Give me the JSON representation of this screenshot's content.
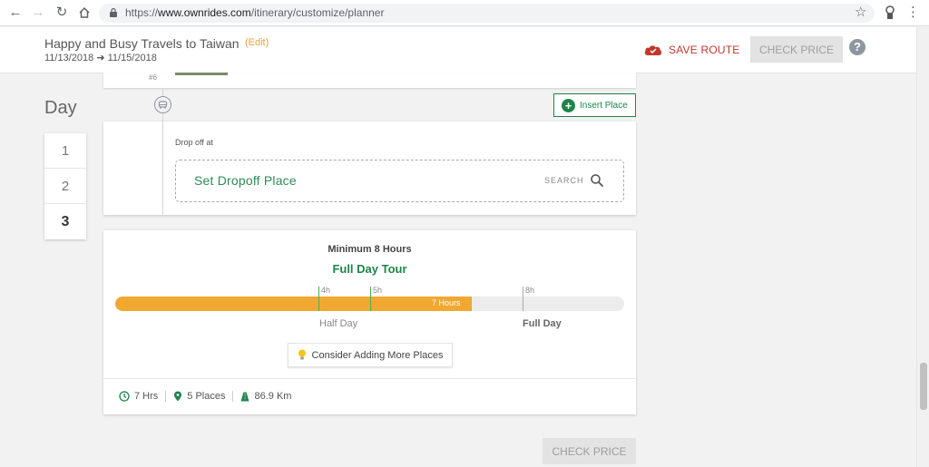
{
  "browser": {
    "url_prefix": "https://",
    "url_domain": "www.ownrides.com",
    "url_path": "/itinerary/customize/planner"
  },
  "header": {
    "title": "Happy and Busy Travels to Taiwan",
    "edit_label": "(Edit)",
    "start_date": "11/13/2018",
    "end_date": "11/15/2018",
    "save_route_label": "SAVE ROUTE",
    "check_price_label": "CHECK PRICE",
    "help_label": "?"
  },
  "day_selector": {
    "label": "Day",
    "days": [
      "1",
      "2",
      "3"
    ],
    "active_index": 2
  },
  "previous_card": {
    "number": "#6"
  },
  "insert_place": {
    "label": "Insert Place"
  },
  "dropoff": {
    "label": "Drop off at",
    "placeholder": "Set Dropoff Place",
    "search_label": "SEARCH"
  },
  "summary": {
    "minimum": "Minimum 8 Hours",
    "tour_type": "Full Day Tour",
    "progress_hours": 7,
    "progress_max_hours": 10,
    "progress_label": "7 Hours",
    "ticks": [
      {
        "label": "4h",
        "hours": 4,
        "color": "#4caf50"
      },
      {
        "label": "5h",
        "hours": 5,
        "color": "#4caf50"
      },
      {
        "label": "8h",
        "hours": 8,
        "color": "#aaaaaa"
      }
    ],
    "half_day_label": "Half Day",
    "full_day_label": "Full Day",
    "consider_label": "Consider Adding More Places",
    "stats": {
      "hours": "7 Hrs",
      "places": "5 Places",
      "distance": "86.9 Km"
    }
  },
  "bottom": {
    "check_price_label": "CHECK PRICE"
  },
  "colors": {
    "accent_green": "#1e8449",
    "progress_orange": "#f0a830",
    "save_red": "#c0392b",
    "edit_orange": "#e8a33d"
  },
  "icons": {
    "back": "arrow-left-icon",
    "forward": "arrow-right-icon",
    "reload": "reload-icon",
    "home": "home-icon",
    "lock": "lock-icon",
    "bookmark": "star-icon",
    "extension": "extension-icon",
    "menu": "kebab-menu-icon",
    "save": "heart-cloud-icon",
    "car": "car-icon",
    "search": "search-icon",
    "bulb": "lightbulb-icon",
    "clock": "clock-icon",
    "pin": "map-pin-icon",
    "road": "road-icon"
  }
}
